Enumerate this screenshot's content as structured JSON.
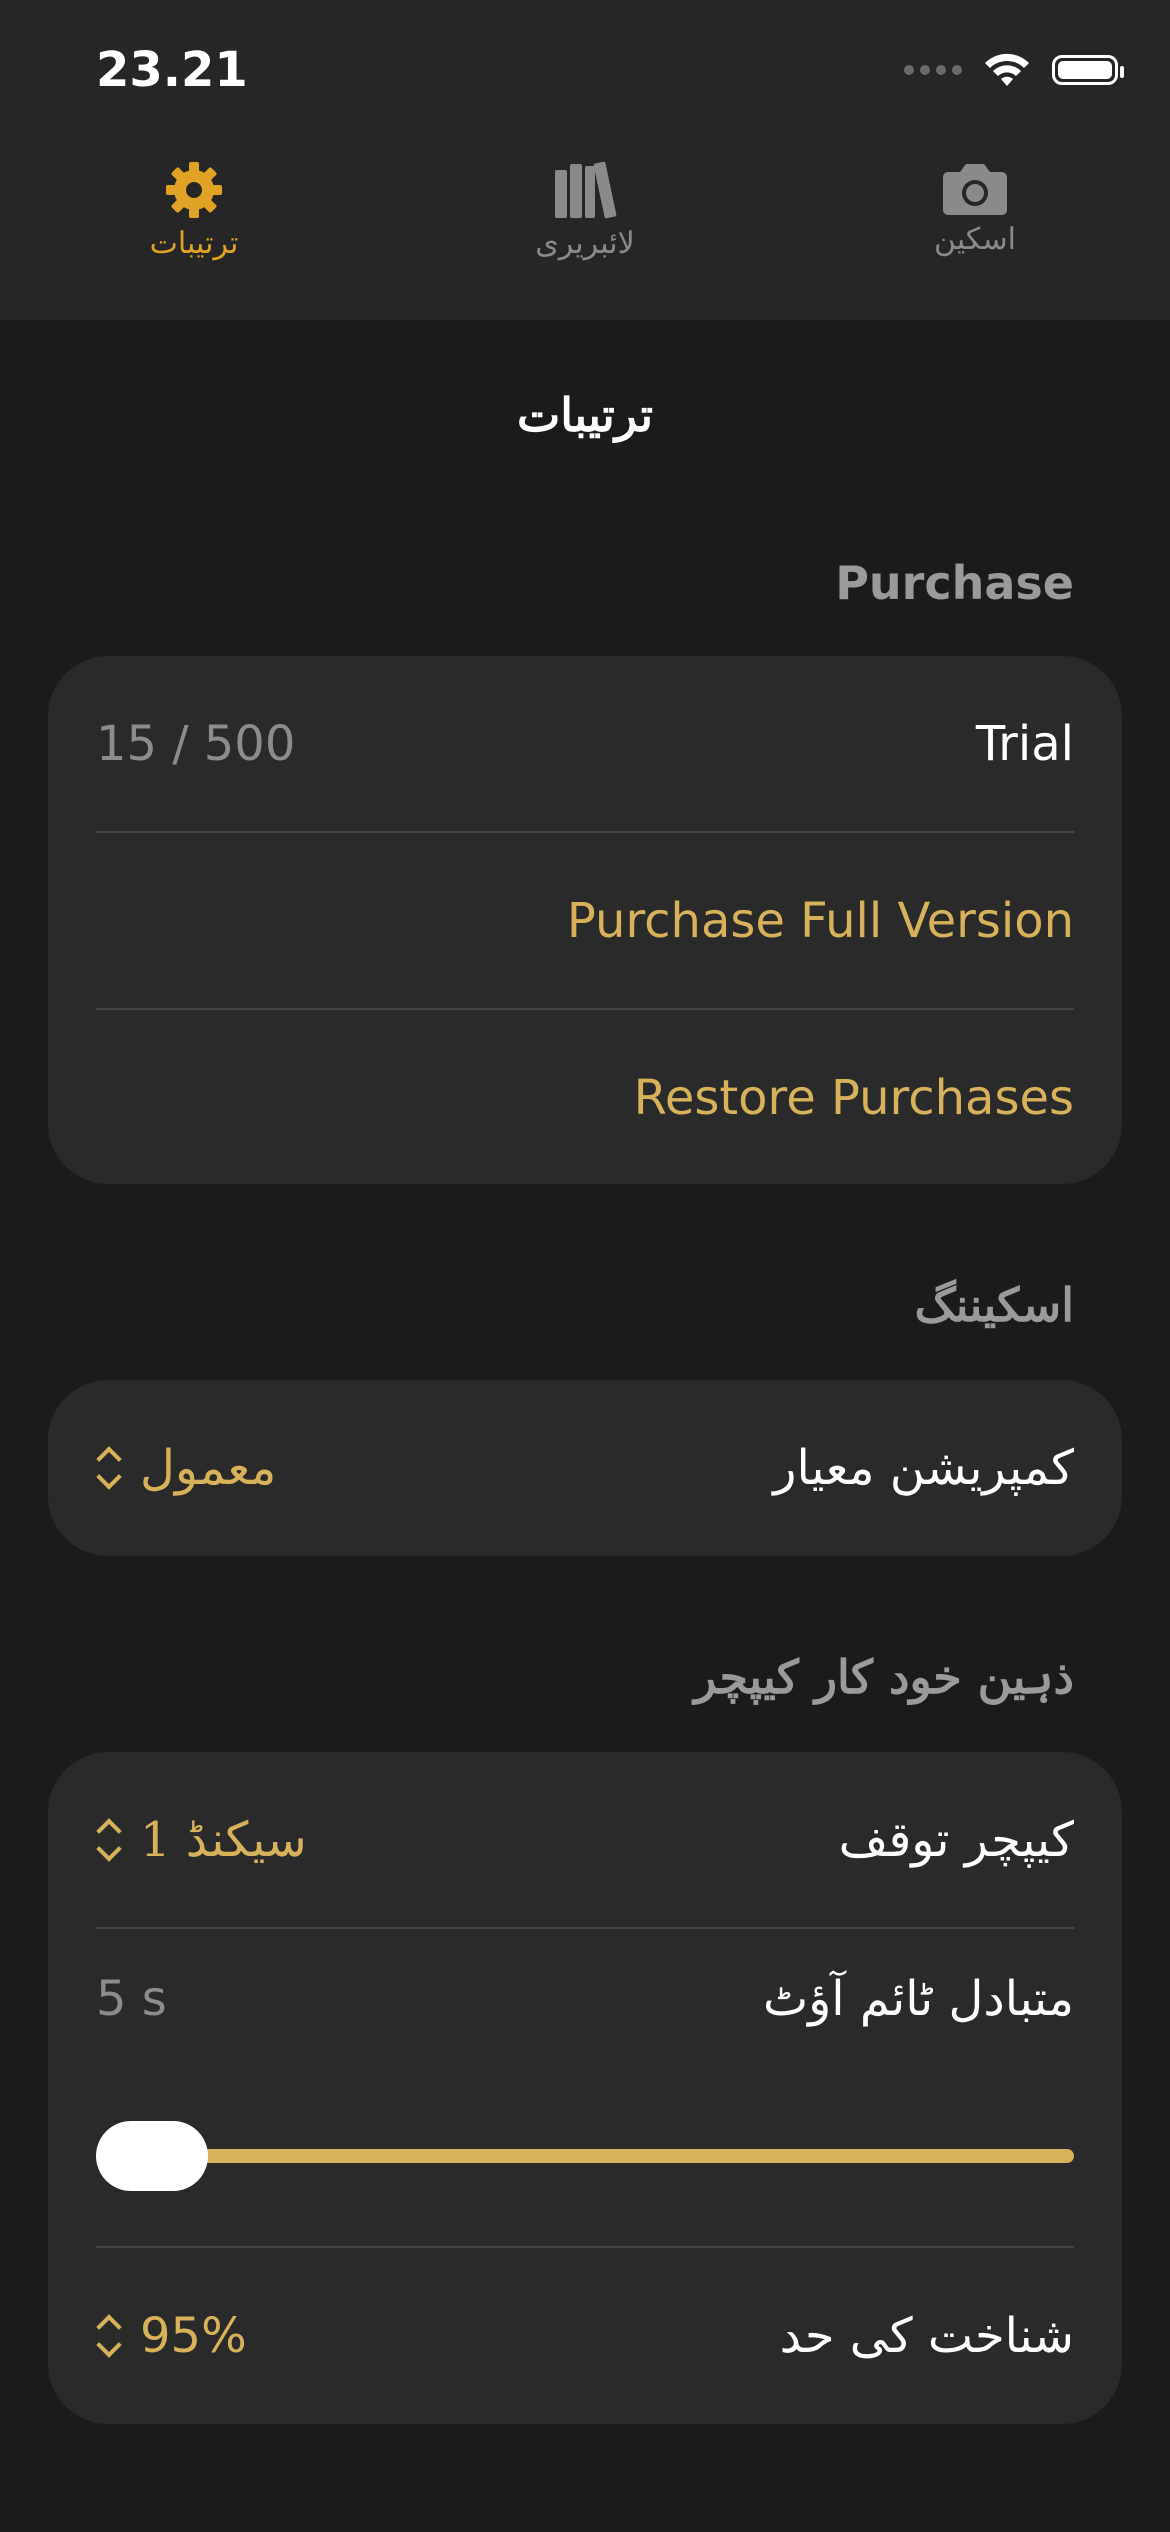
{
  "status_bar": {
    "time": "23.21"
  },
  "tabs": [
    {
      "label": "ترتیبات",
      "icon": "gear-icon",
      "active": true
    },
    {
      "label": "لائبریری",
      "icon": "books-icon",
      "active": false
    },
    {
      "label": "اسکین",
      "icon": "camera-icon",
      "active": false
    }
  ],
  "page_title": "ترتیبات",
  "purchase": {
    "section_title": "Purchase",
    "trial_label": "Trial",
    "trial_value": "15 / 500",
    "purchase_full": "Purchase Full Version",
    "restore": "Restore Purchases"
  },
  "scanning": {
    "section_title": "اسکیننگ",
    "compression_label": "کمپریشن معیار",
    "compression_value": "معمول"
  },
  "auto_capture": {
    "section_title": "ذہین خود کار کیپچر",
    "capture_delay_label": "کیپچر توقف",
    "capture_delay_value": "1 سیکنڈ",
    "alt_timeout_label": "متبادل ٹائم آؤٹ",
    "alt_timeout_value": "5 s",
    "slider_value_fraction": 0.0,
    "threshold_label": "شناخت کی حد",
    "threshold_value": "95%"
  },
  "colors": {
    "accent": "#d7b25a",
    "active_tab": "#e0a326",
    "background": "#1b1b1b",
    "card": "#2a2a2a"
  }
}
